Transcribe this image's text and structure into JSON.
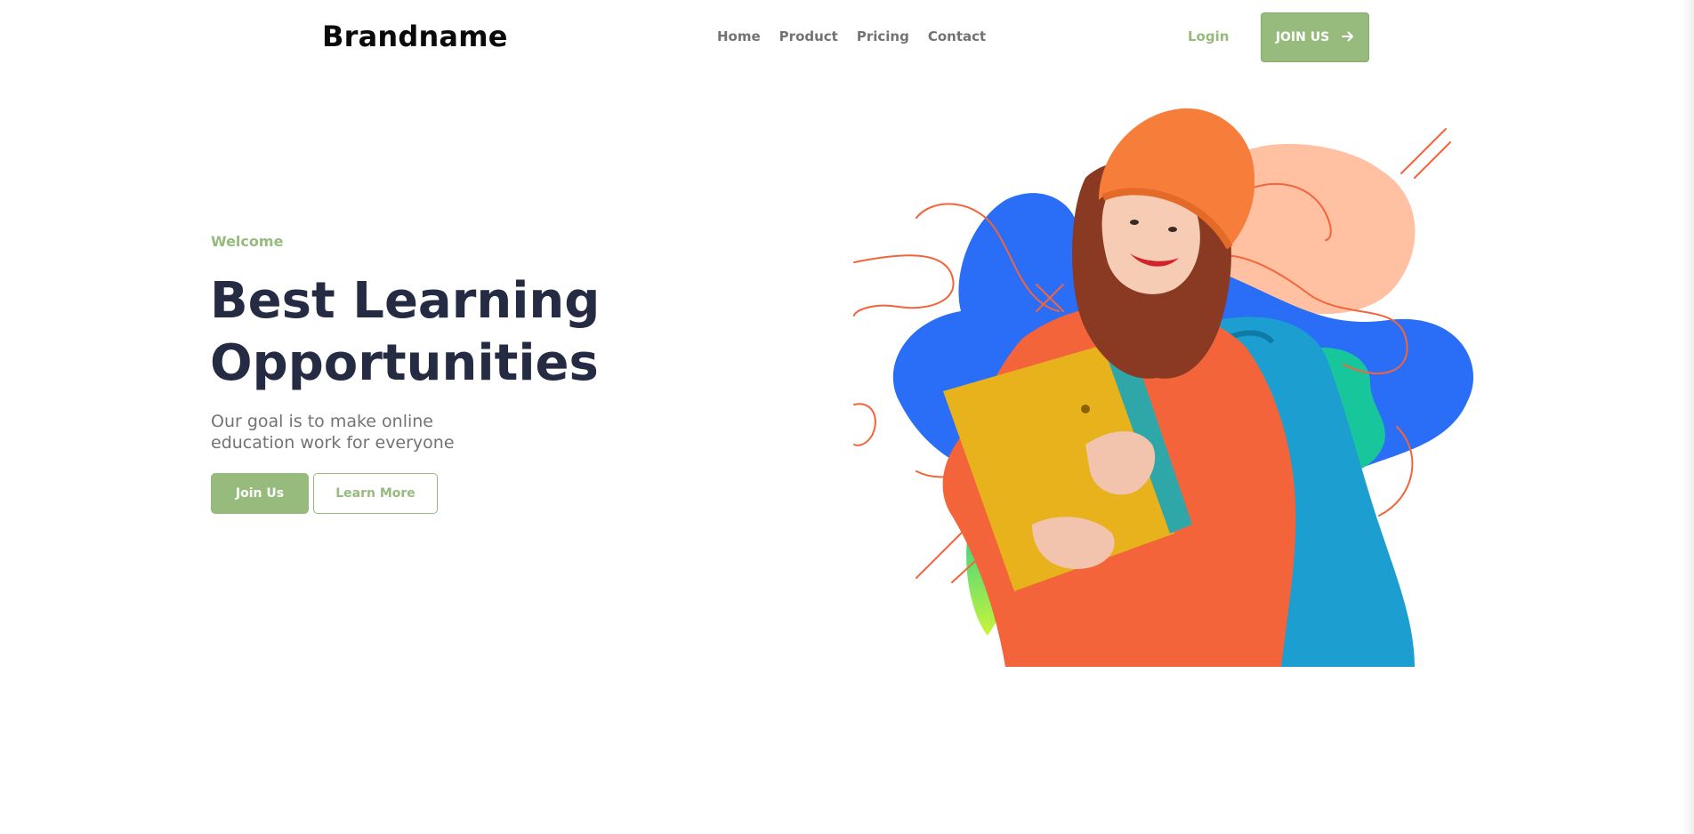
{
  "header": {
    "brand": "Brandname",
    "nav": [
      "Home",
      "Product",
      "Pricing",
      "Contact"
    ],
    "login_label": "Login",
    "join_label": "JOIN US",
    "join_icon": "arrow-right-icon"
  },
  "hero": {
    "eyebrow": "Welcome",
    "title_line1": "Best Learning",
    "title_line2": "Opportunities",
    "subtitle": "Our goal is to make online education work for everyone",
    "primary_cta": "Join Us",
    "secondary_cta": "Learn More",
    "illustration": "student-with-folders-illustration"
  },
  "colors": {
    "accent_green": "#96bb7c",
    "heading": "#252b42",
    "muted_text": "#737373",
    "blob_blue": "#2a6ef8",
    "blob_peach": "#ffc1a2",
    "blob_teal": "#17c79b",
    "sweater_orange": "#f3643b",
    "hat_orange": "#f77e3a",
    "folder_yellow": "#e8b21c",
    "backpack_blue": "#1c9ed0"
  }
}
